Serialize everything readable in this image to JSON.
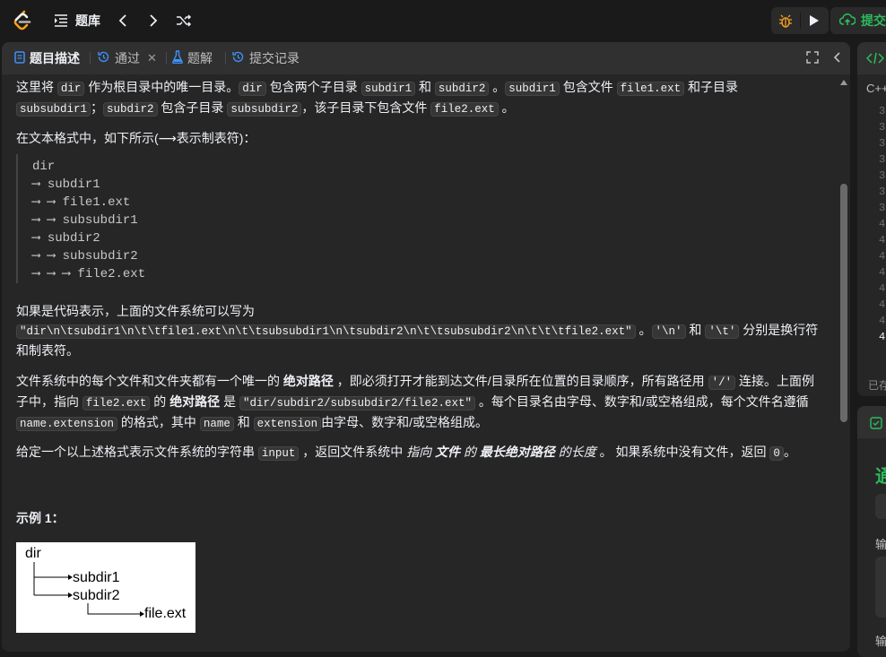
{
  "topbar": {
    "problem_list_label": "题库",
    "submit_label": "提交"
  },
  "tabs": {
    "description": "题目描述",
    "accepted": "通过",
    "solutions": "题解",
    "submissions": "提交记录"
  },
  "content": {
    "p1_a": "这里将 ",
    "p1_code_dir": "dir",
    "p1_b": " 作为根目录中的唯一目录。",
    "p1_code_dir2": "dir",
    "p1_c": " 包含两个子目录 ",
    "p1_code_subdir1": "subdir1",
    "p1_d": " 和 ",
    "p1_code_subdir2": "subdir2",
    "p1_e": " 。",
    "p1_code_subdir1b": "subdir1",
    "p1_f": " 包含文件 ",
    "p1_code_file1": "file1.ext",
    "p1_g": " 和子目录 ",
    "p1_code_subsubdir1": "subsubdir1",
    "p1_h": "；",
    "p1_code_subdir2b": "subdir2",
    "p1_i": " 包含子目录 ",
    "p1_code_subsubdir2": "subsubdir2",
    "p1_j": "，该子目录下包含文件 ",
    "p1_code_file2": "file2.ext",
    "p1_k": " 。",
    "p2": "在文本格式中，如下所示(⟶表示制表符)：",
    "tree_lines": [
      "dir",
      "⟶ subdir1",
      "⟶ ⟶ file1.ext",
      "⟶ ⟶ subsubdir1",
      "⟶ subdir2",
      "⟶ ⟶ subsubdir2",
      "⟶ ⟶ ⟶ file2.ext"
    ],
    "p3_a": "如果是代码表示，上面的文件系统可以写为",
    "p3_code": "\"dir\\n\\tsubdir1\\n\\t\\tfile1.ext\\n\\t\\tsubsubdir1\\n\\tsubdir2\\n\\t\\tsubsubdir2\\n\\t\\t\\tfile2.ext\"",
    "p3_b": " 。",
    "p3_code_n": "'\\n'",
    "p3_c": " 和 ",
    "p3_code_t": "'\\t'",
    "p3_d": " 分别是换行符和制表符。",
    "p4_a": "文件系统中的每个文件和文件夹都有一个唯一的 ",
    "p4_bold1": "绝对路径",
    "p4_b": " ，即必须打开才能到达文件/目录所在位置的目录顺序，所有路径用 ",
    "p4_code_slash": "'/'",
    "p4_c": " 连接。上面例子中，指向 ",
    "p4_code_file2": "file2.ext",
    "p4_d": " 的 ",
    "p4_bold2": "绝对路径",
    "p4_e": " 是 ",
    "p4_code_path": "\"dir/subdir2/subsubdir2/file2.ext\"",
    "p4_f": " 。每个目录名由字母、数字和/或空格组成，每个文件名遵循 ",
    "p4_code_name_ext": "name.extension",
    "p4_g": " 的格式，其中 ",
    "p4_code_name": "name",
    "p4_h": " 和 ",
    "p4_code_extension": "extension",
    "p4_i": "由字母、数字和/或空格组成。",
    "p5_a": "给定一个以上述格式表示文件系统的字符串 ",
    "p5_code_input": "input",
    "p5_b": " ，返回文件系统中 ",
    "p5_i1": "指向",
    "p5_bold1": " 文件 ",
    "p5_i2": "的 ",
    "p5_bold2": "最长绝对路径",
    "p5_i3": " 的长度",
    "p5_c": " 。 如果系统中没有文件，返回 ",
    "p5_code_zero": "0",
    "p5_d": "。",
    "example_title": "示例 1：",
    "figure": {
      "root": "dir",
      "a": "subdir1",
      "b": "subdir2",
      "c": "file.ext"
    }
  },
  "right_panel": {
    "lang": "C++",
    "line_numbers": [
      "3",
      "3",
      "3",
      "3",
      "3",
      "3",
      "3",
      "4",
      "4",
      "4",
      "4",
      "4",
      "4",
      "4",
      "4"
    ],
    "saved": "已存",
    "result": "通",
    "label_input": "输",
    "label_output": "输"
  }
}
